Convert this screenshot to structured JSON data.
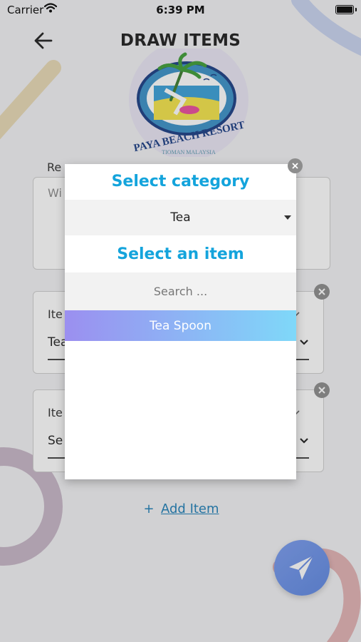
{
  "status_bar": {
    "carrier": "Carrier",
    "time": "6:39 PM"
  },
  "header": {
    "title": "DRAW ITEMS",
    "back_icon": "arrow-left-icon"
  },
  "logo": {
    "text_main": "PAYA BEACH RESORT",
    "text_sub": "TIOMAN MALAYSIA"
  },
  "form": {
    "remark_label": "Re",
    "remark_placeholder": "Wi",
    "item_cards": [
      {
        "label": "Ite",
        "value": "Tea"
      },
      {
        "label": "Ite",
        "value": "Se"
      }
    ],
    "add_item_label": "Add Item"
  },
  "modal": {
    "category_heading": "Select category",
    "category_value": "Tea",
    "item_heading": "Select an item",
    "search_placeholder": "Search ...",
    "options": [
      "Tea Spoon"
    ]
  },
  "colors": {
    "accent": "#14a4dc",
    "link": "#1f7fb8",
    "option_gradient_start": "#9b8ff0",
    "option_gradient_end": "#7fd8f9",
    "fab": "#6b8ee6"
  }
}
